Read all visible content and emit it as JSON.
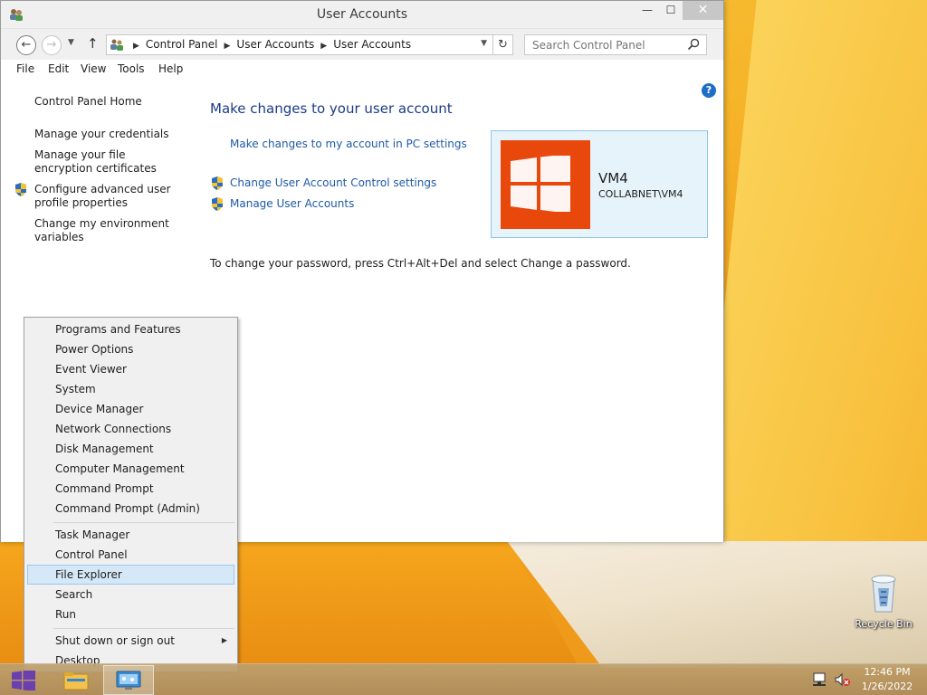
{
  "window": {
    "title": "User Accounts",
    "buttons": {
      "minimize": "—",
      "maximize": "☐",
      "close": "✕"
    }
  },
  "address": {
    "breadcrumbs": [
      "Control Panel",
      "User Accounts",
      "User Accounts"
    ],
    "search_placeholder": "Search Control Panel"
  },
  "menubar": [
    "File",
    "Edit",
    "View",
    "Tools",
    "Help"
  ],
  "sidebar": {
    "home": "Control Panel Home",
    "links": [
      "Manage your credentials",
      "Manage your file encryption certificates",
      "Configure advanced user profile properties",
      "Change my environment variables"
    ]
  },
  "main": {
    "title": "Make changes to your user account",
    "links": [
      "Make changes to my account in PC settings",
      "Change User Account Control settings",
      "Manage User Accounts"
    ],
    "note": "To change your password, press Ctrl+Alt+Del and select Change a password."
  },
  "user": {
    "name": "VM4",
    "domain": "COLLABNET\\VM4"
  },
  "context_menu": {
    "group1": [
      "Programs and Features",
      "Power Options",
      "Event Viewer",
      "System",
      "Device Manager",
      "Network Connections",
      "Disk Management",
      "Computer Management",
      "Command Prompt",
      "Command Prompt (Admin)"
    ],
    "group2": [
      "Task Manager",
      "Control Panel",
      "File Explorer",
      "Search",
      "Run"
    ],
    "group3": [
      "Shut down or sign out",
      "Desktop"
    ],
    "highlighted": "File Explorer"
  },
  "desktop": {
    "recycle_bin": "Recycle Bin"
  },
  "taskbar": {
    "time": "12:46 PM",
    "date": "1/26/2022"
  },
  "colors": {
    "accent": "#e9480d",
    "link": "#1e5aa6",
    "card_bg": "#e6f3fb",
    "highlight": "#d5e8f7"
  }
}
